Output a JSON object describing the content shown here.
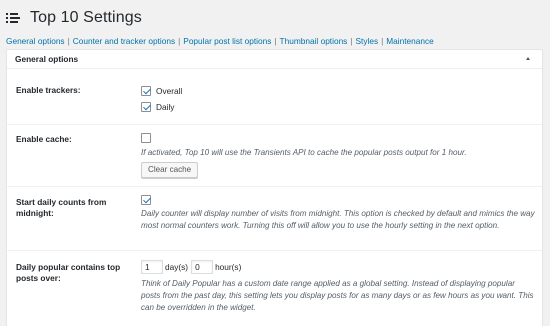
{
  "page": {
    "title": "Top 10 Settings"
  },
  "nav": {
    "items": [
      "General options",
      "Counter and tracker options",
      "Popular post list options",
      "Thumbnail options",
      "Styles",
      "Maintenance"
    ],
    "separator": "|"
  },
  "panel": {
    "heading": "General options",
    "trackers": {
      "label": "Enable trackers:",
      "overall": "Overall",
      "daily": "Daily",
      "overall_checked": true,
      "daily_checked": true
    },
    "cache": {
      "label": "Enable cache:",
      "checked": false,
      "description": "If activated, Top 10 will use the Transients API to cache the popular posts output for 1 hour.",
      "button": "Clear cache"
    },
    "midnight": {
      "label": "Start daily counts from midnight:",
      "checked": true,
      "description": "Daily counter will display number of visits from midnight. This option is checked by default and mimics the way most normal counters work. Turning this off will allow you to use the hourly setting in the next option."
    },
    "daily_range": {
      "label": "Daily popular contains top posts over:",
      "days_value": "1",
      "days_unit": "day(s)",
      "hours_value": "0",
      "hours_unit": "hour(s)",
      "description": "Think of Daily Popular has a custom date range applied as a global setting. Instead of displaying popular posts from the past day, this setting lets you display posts for as many days or as few hours as you want. This can be overridden in the widget."
    }
  }
}
